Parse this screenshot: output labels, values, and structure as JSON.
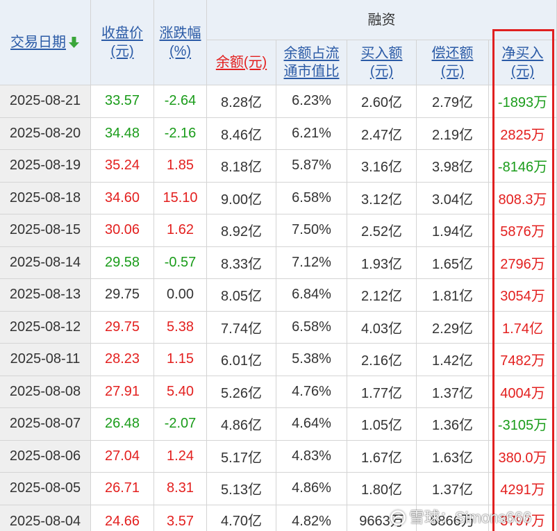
{
  "header": {
    "date": "交易日期",
    "close_line1": "收盘价",
    "close_line2": "(元)",
    "change_line1": "涨跌幅",
    "change_line2": "(%)",
    "financing_group": "融资",
    "balance": "余额(元)",
    "ratio_line1": "余额占流",
    "ratio_line2": "通市值比",
    "buy_line1": "买入额",
    "buy_line2": "(元)",
    "repay_line1": "偿还额",
    "repay_line2": "(元)",
    "net_line1": "净买入",
    "net_line2": "(元)"
  },
  "icons": {
    "sort": "sort-descending-arrow-icon",
    "watermark_logo": "xueqiu-snowball-logo-icon"
  },
  "colors": {
    "up": "#e3201f",
    "down": "#1a9c1a",
    "flat": "#333333",
    "link": "#2a5aa6",
    "highlight_box": "#e02020",
    "sort_arrow": "#3aa63a"
  },
  "rows": [
    {
      "date": "2025-08-21",
      "close": "33.57",
      "change": "-2.64",
      "balance": "8.28亿",
      "ratio": "6.23%",
      "buy": "2.60亿",
      "repay": "2.79亿",
      "net_buy": "-1893万"
    },
    {
      "date": "2025-08-20",
      "close": "34.48",
      "change": "-2.16",
      "balance": "8.46亿",
      "ratio": "6.21%",
      "buy": "2.47亿",
      "repay": "2.19亿",
      "net_buy": "2825万"
    },
    {
      "date": "2025-08-19",
      "close": "35.24",
      "change": "1.85",
      "balance": "8.18亿",
      "ratio": "5.87%",
      "buy": "3.16亿",
      "repay": "3.98亿",
      "net_buy": "-8146万"
    },
    {
      "date": "2025-08-18",
      "close": "34.60",
      "change": "15.10",
      "balance": "9.00亿",
      "ratio": "6.58%",
      "buy": "3.12亿",
      "repay": "3.04亿",
      "net_buy": "808.3万"
    },
    {
      "date": "2025-08-15",
      "close": "30.06",
      "change": "1.62",
      "balance": "8.92亿",
      "ratio": "7.50%",
      "buy": "2.52亿",
      "repay": "1.94亿",
      "net_buy": "5876万"
    },
    {
      "date": "2025-08-14",
      "close": "29.58",
      "change": "-0.57",
      "balance": "8.33亿",
      "ratio": "7.12%",
      "buy": "1.93亿",
      "repay": "1.65亿",
      "net_buy": "2796万"
    },
    {
      "date": "2025-08-13",
      "close": "29.75",
      "change": "0.00",
      "balance": "8.05亿",
      "ratio": "6.84%",
      "buy": "2.12亿",
      "repay": "1.81亿",
      "net_buy": "3054万"
    },
    {
      "date": "2025-08-12",
      "close": "29.75",
      "change": "5.38",
      "balance": "7.74亿",
      "ratio": "6.58%",
      "buy": "4.03亿",
      "repay": "2.29亿",
      "net_buy": "1.74亿"
    },
    {
      "date": "2025-08-11",
      "close": "28.23",
      "change": "1.15",
      "balance": "6.01亿",
      "ratio": "5.38%",
      "buy": "2.16亿",
      "repay": "1.42亿",
      "net_buy": "7482万"
    },
    {
      "date": "2025-08-08",
      "close": "27.91",
      "change": "5.40",
      "balance": "5.26亿",
      "ratio": "4.76%",
      "buy": "1.77亿",
      "repay": "1.37亿",
      "net_buy": "4004万"
    },
    {
      "date": "2025-08-07",
      "close": "26.48",
      "change": "-2.07",
      "balance": "4.86亿",
      "ratio": "4.64%",
      "buy": "1.05亿",
      "repay": "1.36亿",
      "net_buy": "-3105万"
    },
    {
      "date": "2025-08-06",
      "close": "27.04",
      "change": "1.24",
      "balance": "5.17亿",
      "ratio": "4.83%",
      "buy": "1.67亿",
      "repay": "1.63亿",
      "net_buy": "380.0万"
    },
    {
      "date": "2025-08-05",
      "close": "26.71",
      "change": "8.31",
      "balance": "5.13亿",
      "ratio": "4.86%",
      "buy": "1.80亿",
      "repay": "1.37亿",
      "net_buy": "4291万"
    },
    {
      "date": "2025-08-04",
      "close": "24.66",
      "change": "3.57",
      "balance": "4.70亿",
      "ratio": "4.82%",
      "buy": "9663万",
      "repay": "5866万",
      "net_buy": "3797万"
    }
  ],
  "watermark": "雪球：Simons666"
}
